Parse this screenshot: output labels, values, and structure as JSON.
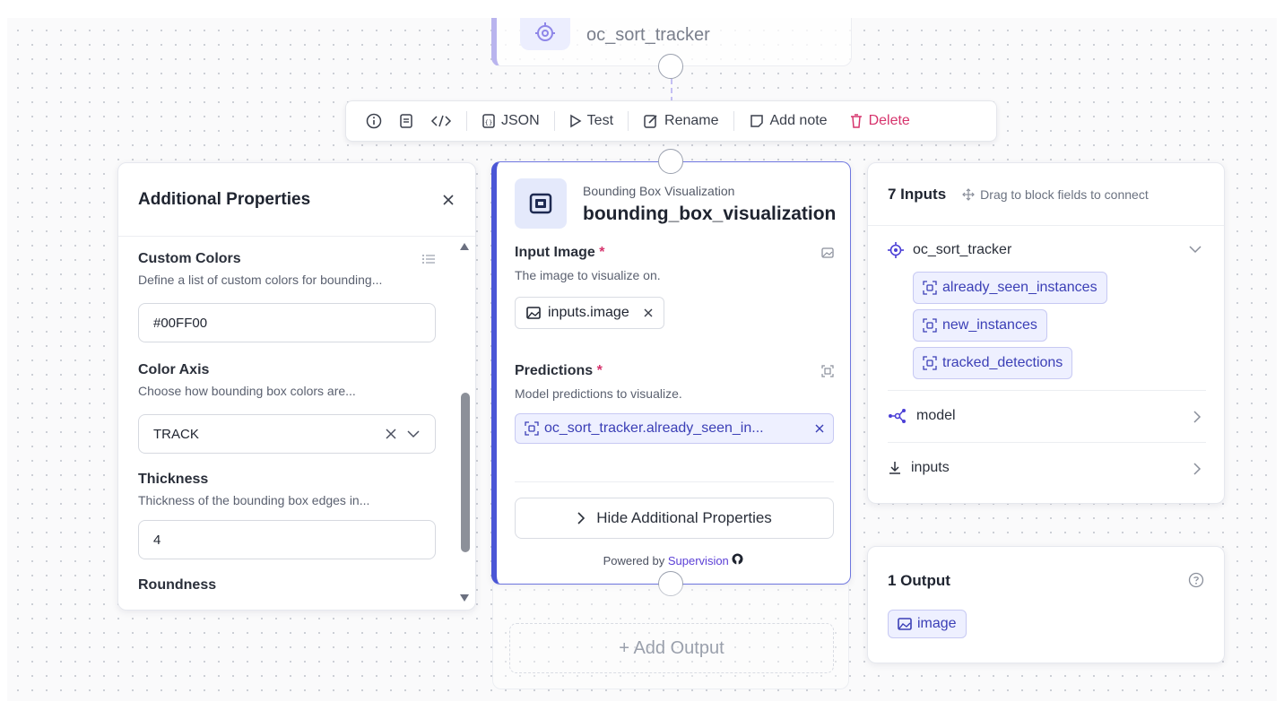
{
  "upstream_node": {
    "title": "oc_sort_tracker"
  },
  "toolbar": {
    "json_label": "JSON",
    "test_label": "Test",
    "rename_label": "Rename",
    "add_note_label": "Add note",
    "delete_label": "Delete"
  },
  "additional_properties": {
    "title": "Additional Properties",
    "fields": [
      {
        "title": "Custom Colors",
        "description": "Define a list of custom colors for bounding...",
        "value": "#00FF00"
      },
      {
        "title": "Color Axis",
        "description": "Choose how bounding box colors are...",
        "value": "TRACK"
      },
      {
        "title": "Thickness",
        "description": "Thickness of the bounding box edges in...",
        "value": "4"
      },
      {
        "title": "Roundness"
      }
    ]
  },
  "block": {
    "type_label": "Bounding Box Visualization",
    "name": "bounding_box_visualization",
    "input_image": {
      "label": "Input Image",
      "required_mark": "*",
      "description": "The image to visualize on.",
      "value": "inputs.image"
    },
    "predictions": {
      "label": "Predictions",
      "required_mark": "*",
      "description": "Model predictions to visualize.",
      "value": "oc_sort_tracker.already_seen_in..."
    },
    "hide_button": "Hide Additional Properties",
    "powered_by": "Powered by",
    "powered_brand": "Supervision"
  },
  "add_output": {
    "label": "+ Add Output"
  },
  "inputs_panel": {
    "count_label": "7 Inputs",
    "hint": "Drag to block fields to connect",
    "groups": [
      {
        "name": "oc_sort_tracker",
        "fields": [
          "already_seen_instances",
          "new_instances",
          "tracked_detections"
        ]
      },
      {
        "name": "model"
      },
      {
        "name": "inputs"
      }
    ]
  },
  "outputs_panel": {
    "count_label": "1 Output",
    "outputs": [
      "image"
    ]
  },
  "colors": {
    "accent": "#4b56d6",
    "chip_bg": "#eef0ff",
    "chip_text": "#3b3fb6",
    "delete": "#d6336c",
    "brand": "#5b3fd6"
  }
}
